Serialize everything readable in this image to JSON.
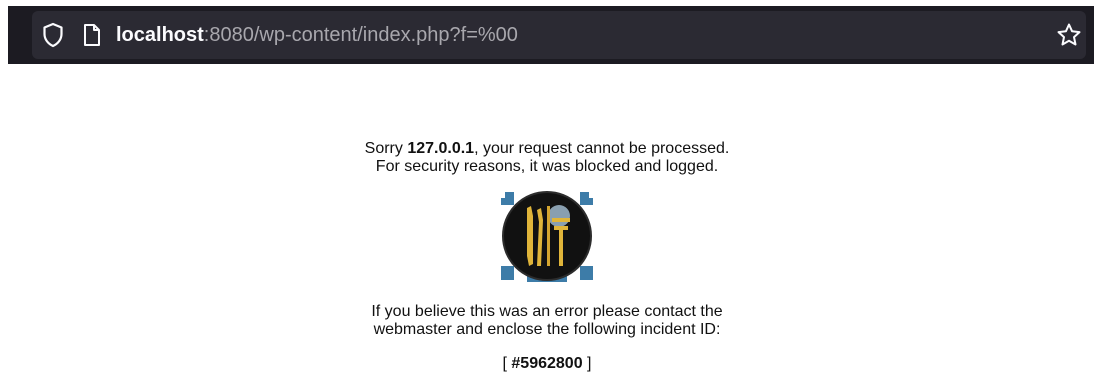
{
  "browser": {
    "url_host": "localhost",
    "url_rest": ":8080/wp-content/index.php?f=%00",
    "icons": {
      "shield": "shield-icon",
      "page": "page-icon",
      "bookmark": "star-icon"
    },
    "colors": {
      "toolbar": "#1c1b22",
      "urlbar": "#2b2a33",
      "url_host": "#fbfbfe",
      "url_rest": "#a8a7ad"
    }
  },
  "page": {
    "line1_prefix": "Sorry ",
    "ip": "127.0.0.1",
    "line1_suffix": ", your request cannot be processed.",
    "line2": "For security reasons, it was blocked and logged.",
    "line3": "If you believe this was an error please contact the",
    "line4": "webmaster and enclose the following incident ID:",
    "incident_open": "[ ",
    "incident_id": "#5962800",
    "incident_close": " ]",
    "logo_icon": "firewall-logo-icon"
  }
}
